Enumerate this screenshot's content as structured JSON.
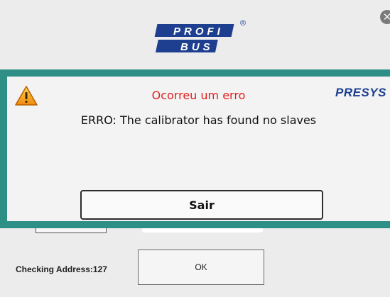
{
  "background": {
    "close_icon": "close-icon",
    "logo": {
      "line1": "PROFI",
      "line2": "BUS",
      "mark": "®"
    },
    "checking_label": "Checking Address:127",
    "ok_label": "OK"
  },
  "dialog": {
    "title": "Ocorreu um erro",
    "brand": "PRESYS",
    "message": "ERRO: The calibrator has found no slaves",
    "exit_label": "Sair",
    "warning_icon": "warning-icon",
    "colors": {
      "frame": "#2e8f86",
      "title": "#e02020",
      "brand": "#1e3f8f",
      "warning": "#f0a020"
    }
  }
}
